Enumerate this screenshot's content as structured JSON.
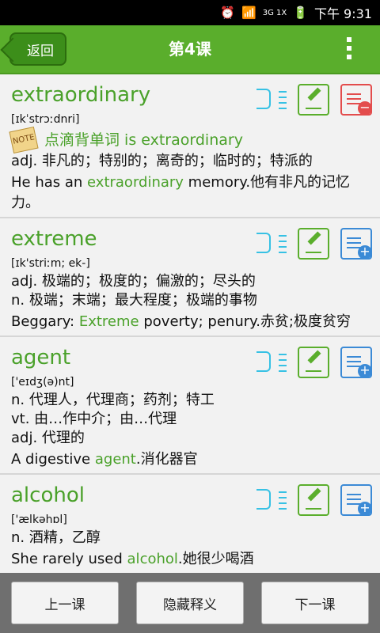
{
  "status": {
    "time": "下午 9:31",
    "network": "3G 1X"
  },
  "appbar": {
    "back_label": "返回",
    "title": "第4课"
  },
  "entries": [
    {
      "word": "extraordinary",
      "phonetic": "[ɪkˈstrɔːdnri]",
      "note": "点滴背单词 is extraordinary",
      "defs": [
        "adj. 非凡的；特别的；离奇的；临时的；特派的"
      ],
      "example_before": "He has an ",
      "example_hl": "extraordinary",
      "example_after": " memory.他有非凡的记忆力。",
      "state": "added"
    },
    {
      "word": "extreme",
      "phonetic": "[ɪk'striːm; ek-]",
      "defs": [
        "adj. 极端的；极度的；偏激的；尽头的",
        "n. 极端；末端；最大程度；极端的事物"
      ],
      "example_before": "Beggary: ",
      "example_hl": "Extreme",
      "example_after": " poverty; penury.赤贫;极度贫穷",
      "state": "not-added"
    },
    {
      "word": "agent",
      "phonetic": "['eɪdʒ(ə)nt]",
      "defs": [
        "n. 代理人，代理商；药剂；特工",
        "vt. 由…作中介；由…代理",
        "adj. 代理的"
      ],
      "example_before": "A digestive ",
      "example_hl": "agent",
      "example_after": ".消化器官",
      "state": "not-added"
    },
    {
      "word": "alcohol",
      "phonetic": "['ælkəhɒl]",
      "defs": [
        "n. 酒精，乙醇"
      ],
      "example_before": "She rarely used ",
      "example_hl": "alcohol",
      "example_after": ".她很少喝酒",
      "state": "not-added"
    }
  ],
  "bottom": {
    "prev": "上一课",
    "hide": "隐藏释义",
    "next": "下一课"
  }
}
